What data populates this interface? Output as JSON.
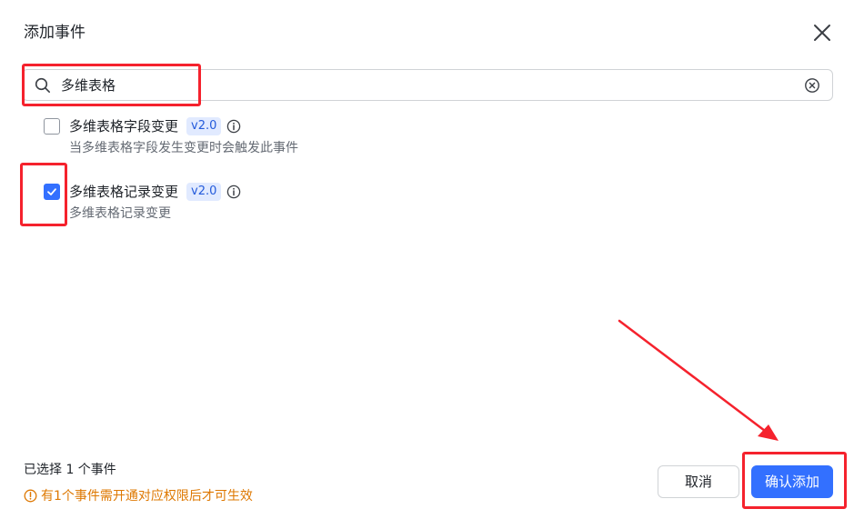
{
  "dialog": {
    "title": "添加事件"
  },
  "search": {
    "value": "多维表格"
  },
  "events": [
    {
      "name": "多维表格字段变更",
      "version": "v2.0",
      "description": "当多维表格字段发生变更时会触发此事件",
      "checked": false
    },
    {
      "name": "多维表格记录变更",
      "version": "v2.0",
      "description": "多维表格记录变更",
      "checked": true
    }
  ],
  "footer": {
    "selected_text": "已选择 1 个事件",
    "warning_text": "有1个事件需开通对应权限后才可生效",
    "cancel_label": "取消",
    "confirm_label": "确认添加"
  },
  "colors": {
    "primary": "#3370ff",
    "warning": "#de7802",
    "annotation": "#f5222d"
  },
  "icons": {
    "close": "close-icon",
    "search": "search-icon",
    "clear": "clear-icon",
    "info": "info-icon",
    "warning": "warning-icon",
    "check": "check-icon"
  }
}
